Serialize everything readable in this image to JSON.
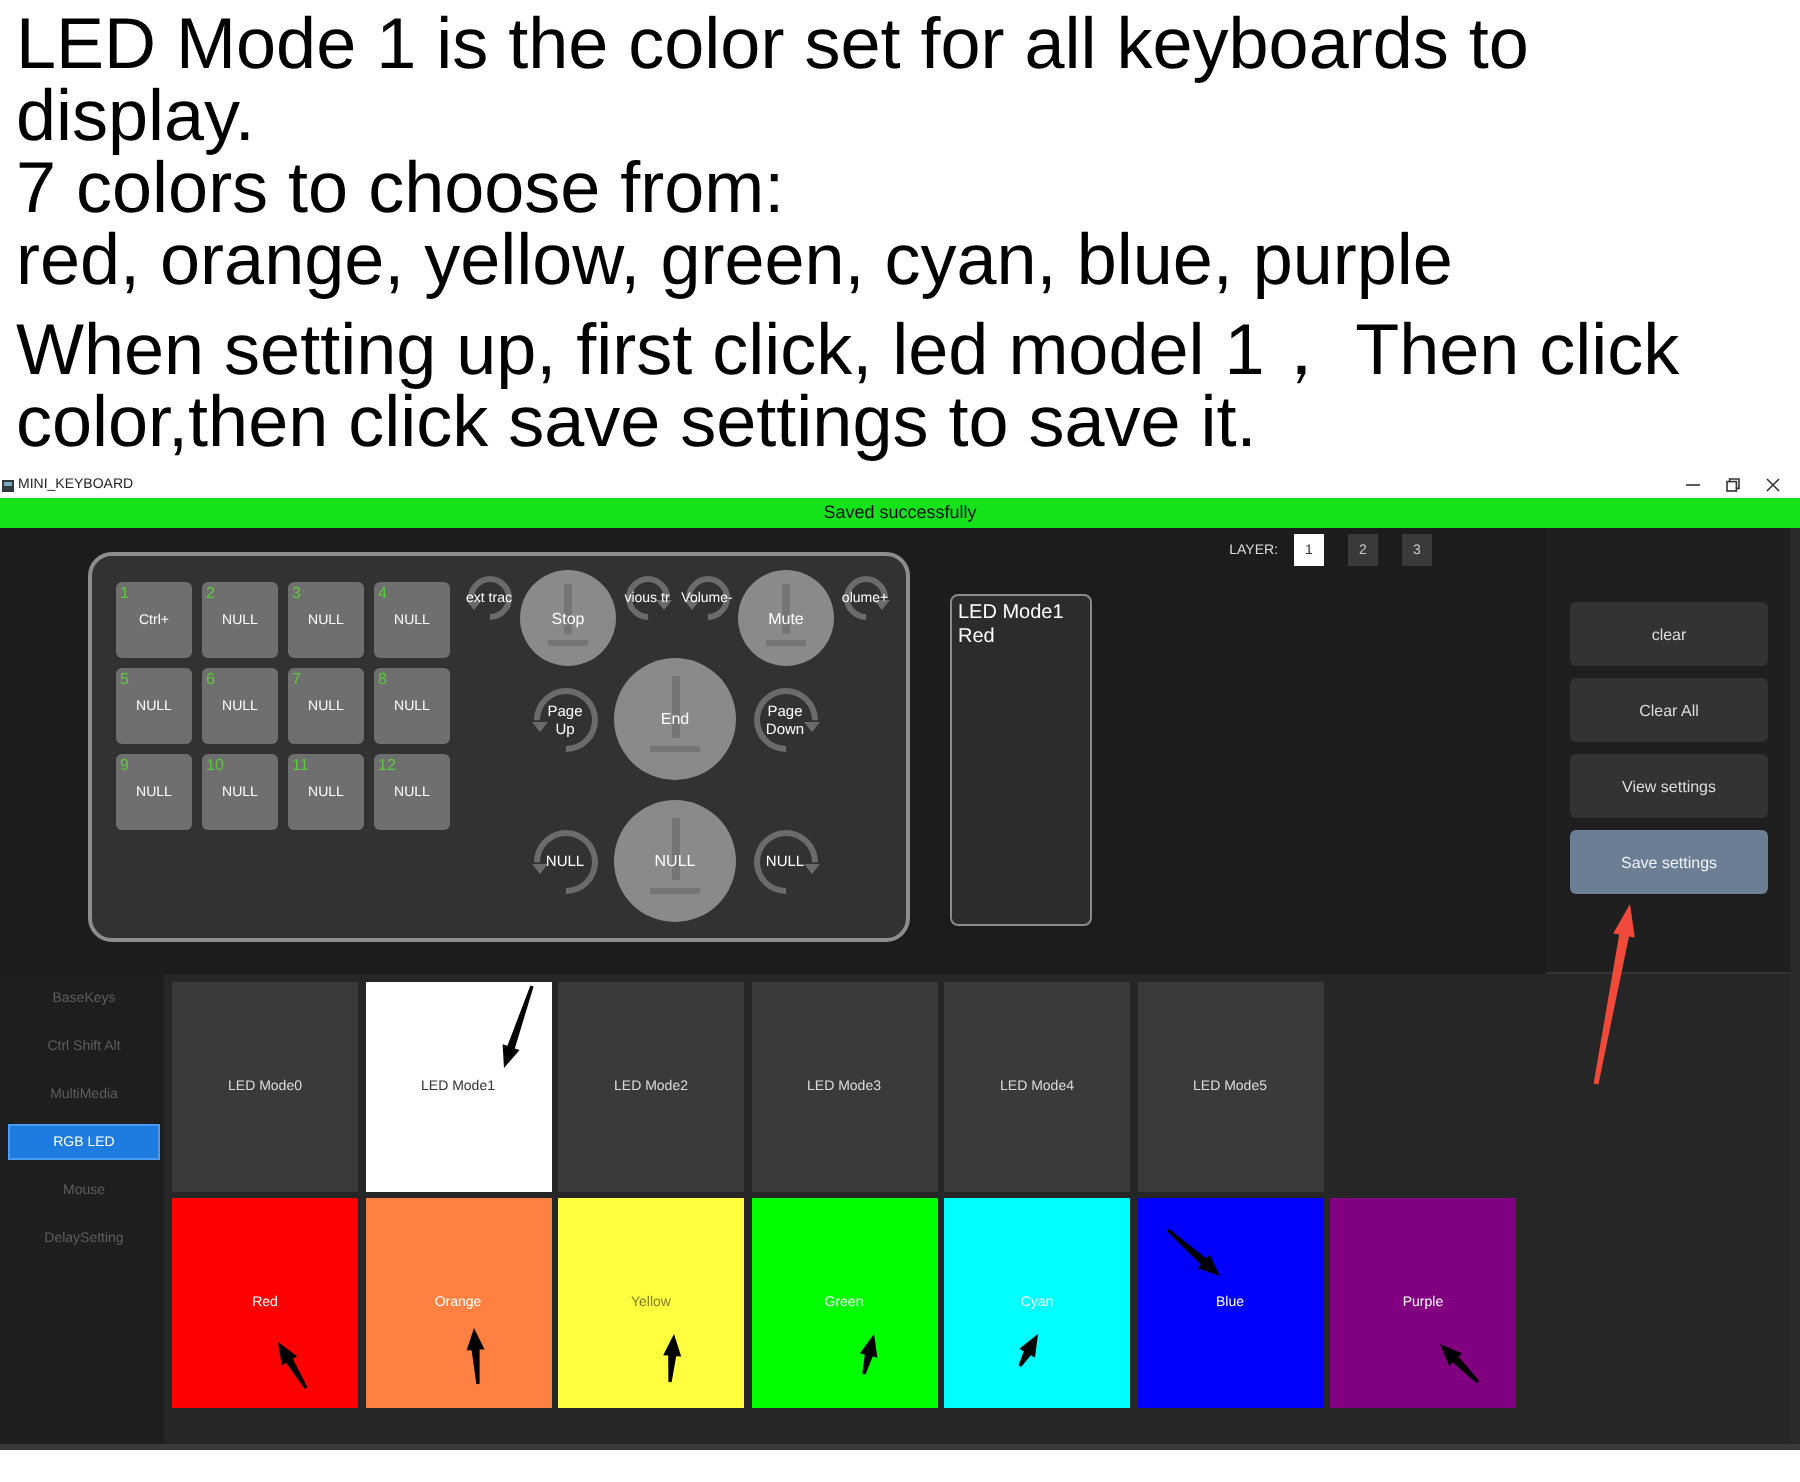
{
  "caption": [
    {
      "lines": [
        "LED Mode 1 is the color set for all keyboards to display.",
        "7 colors to choose from:",
        "red, orange, yellow, green, cyan, blue, purple"
      ]
    },
    {
      "lines": [
        "When setting up, first click, led model 1， Then click color,then click save settings to save it."
      ]
    }
  ],
  "window": {
    "title": "MINI_KEYBOARD"
  },
  "status_banner": {
    "text": "Saved successfully"
  },
  "layers": {
    "label": "LAYER:",
    "items": [
      {
        "label": "1",
        "selected": true
      },
      {
        "label": "2",
        "selected": false
      },
      {
        "label": "3",
        "selected": false
      }
    ]
  },
  "keypad": {
    "keys": [
      {
        "number": "1",
        "label": "Ctrl+"
      },
      {
        "number": "2",
        "label": "NULL"
      },
      {
        "number": "3",
        "label": "NULL"
      },
      {
        "number": "4",
        "label": "NULL"
      },
      {
        "number": "5",
        "label": "NULL"
      },
      {
        "number": "6",
        "label": "NULL"
      },
      {
        "number": "7",
        "label": "NULL"
      },
      {
        "number": "8",
        "label": "NULL"
      },
      {
        "number": "9",
        "label": "NULL"
      },
      {
        "number": "10",
        "label": "NULL"
      },
      {
        "number": "11",
        "label": "NULL"
      },
      {
        "number": "12",
        "label": "NULL"
      }
    ],
    "knob_rows": [
      {
        "knobs": [
          {
            "kind": "ccw",
            "label": "ext trac"
          },
          {
            "kind": "button",
            "label": "Stop"
          },
          {
            "kind": "cw",
            "label": "vious tr"
          },
          {
            "kind": "ccw",
            "label": "Volume-"
          },
          {
            "kind": "button",
            "label": "Mute"
          },
          {
            "kind": "cw",
            "label": "olume+"
          }
        ]
      },
      {
        "knobs": [
          {
            "kind": "ccw",
            "label": "Page Up"
          },
          {
            "kind": "button",
            "label": "End"
          },
          {
            "kind": "cw",
            "label": "Page Down"
          }
        ]
      },
      {
        "knobs": [
          {
            "kind": "ccw",
            "label": "NULL"
          },
          {
            "kind": "button",
            "label": "NULL"
          },
          {
            "kind": "cw",
            "label": "NULL"
          }
        ]
      }
    ]
  },
  "summary": {
    "lines": [
      "LED Mode1",
      "Red"
    ]
  },
  "actions": [
    {
      "label": "clear",
      "highlighted": false
    },
    {
      "label": "Clear All",
      "highlighted": false
    },
    {
      "label": "View settings",
      "highlighted": false
    },
    {
      "label": "Save settings",
      "highlighted": true
    }
  ],
  "sidebar": {
    "items": [
      {
        "label": "BaseKeys",
        "selected": false
      },
      {
        "label": "Ctrl Shift Alt",
        "selected": false
      },
      {
        "label": "MultiMedia",
        "selected": false
      },
      {
        "label": "RGB LED",
        "selected": true
      },
      {
        "label": "Mouse",
        "selected": false
      },
      {
        "label": "DelaySetting",
        "selected": false
      }
    ]
  },
  "led_modes": [
    {
      "label": "LED Mode0",
      "selected": false
    },
    {
      "label": "LED Mode1",
      "selected": true
    },
    {
      "label": "LED Mode2",
      "selected": false
    },
    {
      "label": "LED Mode3",
      "selected": false
    },
    {
      "label": "LED Mode4",
      "selected": false
    },
    {
      "label": "LED Mode5",
      "selected": false
    }
  ],
  "colors": [
    {
      "label": "Red",
      "color": "#ff0000"
    },
    {
      "label": "Orange",
      "color": "#ff8040"
    },
    {
      "label": "Yellow",
      "color": "#ffff40"
    },
    {
      "label": "Green",
      "color": "#00ff00"
    },
    {
      "label": "Cyan",
      "color": "#00ffff"
    },
    {
      "label": "Blue",
      "color": "#0000ff"
    },
    {
      "label": "Purple",
      "color": "#800080"
    }
  ]
}
